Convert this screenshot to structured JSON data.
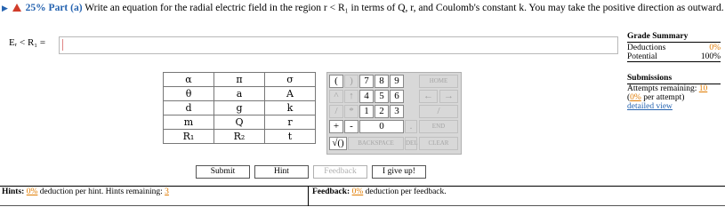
{
  "question": {
    "percent": "25%",
    "part": "Part (a)",
    "text": "Write an equation for the radial electric field in the region r < R₁ in terms of Q, r, and Coulomb's constant k. You may take the positive direction as outward."
  },
  "answer": {
    "label": "Eᵣ < R₁ =",
    "value": ""
  },
  "grade_summary": {
    "title": "Grade Summary",
    "deductions_label": "Deductions",
    "deductions_value": "0%",
    "potential_label": "Potential",
    "potential_value": "100%"
  },
  "submissions": {
    "title": "Submissions",
    "attempts_label": "Attempts remaining:",
    "attempts_value": "10",
    "per_attempt_pct": "0%",
    "per_attempt_label": "per attempt)",
    "detailed_view": "detailed view"
  },
  "symbols": [
    [
      "α",
      "π",
      "σ"
    ],
    [
      "θ",
      "a",
      "A"
    ],
    [
      "d",
      "g",
      "k"
    ],
    [
      "m",
      "Q",
      "r"
    ],
    [
      "R₁",
      "R₂",
      "t"
    ]
  ],
  "keypad": {
    "open_paren": "(",
    "close_paren": ")",
    "digits": [
      "7",
      "8",
      "9",
      "4",
      "5",
      "6",
      "1",
      "2",
      "3",
      "0"
    ],
    "home": "HOME",
    "end": "END",
    "caret": "^",
    "mul": "*",
    "add": "+",
    "sub": "-",
    "dot": ".",
    "sqrt": "√()",
    "backspace": "BACKSPACE",
    "del": "DEL",
    "clear": "CLEAR",
    "slash": "/",
    "left": "←",
    "right": "→"
  },
  "buttons": {
    "submit": "Submit",
    "hint": "Hint",
    "feedback": "Feedback",
    "give_up": "I give up!"
  },
  "footer": {
    "hints_label": "Hints:",
    "hints_pct": "0%",
    "hints_text": "deduction per hint. Hints remaining:",
    "hints_remaining": "3",
    "feedback_label": "Feedback:",
    "feedback_pct": "0%",
    "feedback_text": "deduction per feedback."
  }
}
